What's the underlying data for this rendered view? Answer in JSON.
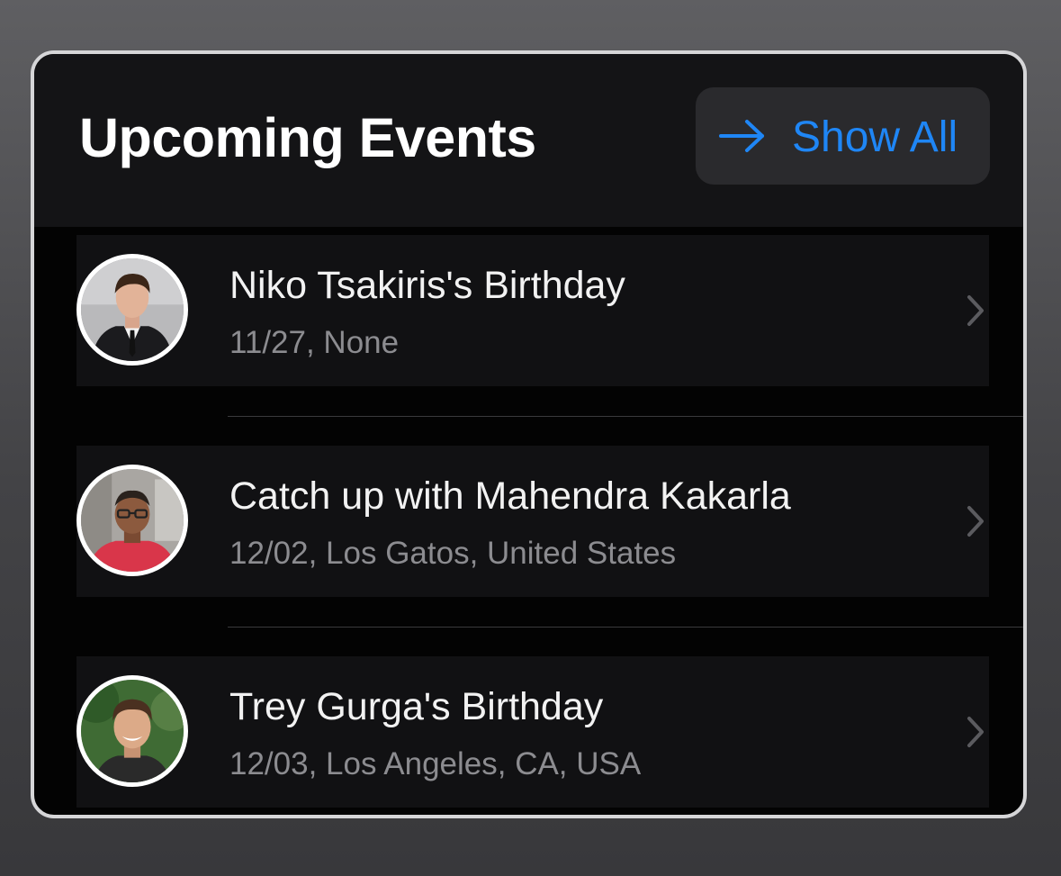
{
  "widget": {
    "title": "Upcoming Events",
    "show_all_label": "Show All",
    "accent_color": "#1f86f5"
  },
  "events": [
    {
      "title": "Niko Tsakiris's Birthday",
      "subtitle": "11/27, None",
      "avatar": "avatar-photo"
    },
    {
      "title": "Catch up with Mahendra Kakarla",
      "subtitle": "12/02, Los Gatos, United States",
      "avatar": "avatar-photo"
    },
    {
      "title": "Trey Gurga's Birthday",
      "subtitle": "12/03, Los Angeles, CA, USA",
      "avatar": "avatar-photo"
    }
  ],
  "icons": {
    "show_all": "arrow-right-icon",
    "row": "chevron-right-icon"
  }
}
